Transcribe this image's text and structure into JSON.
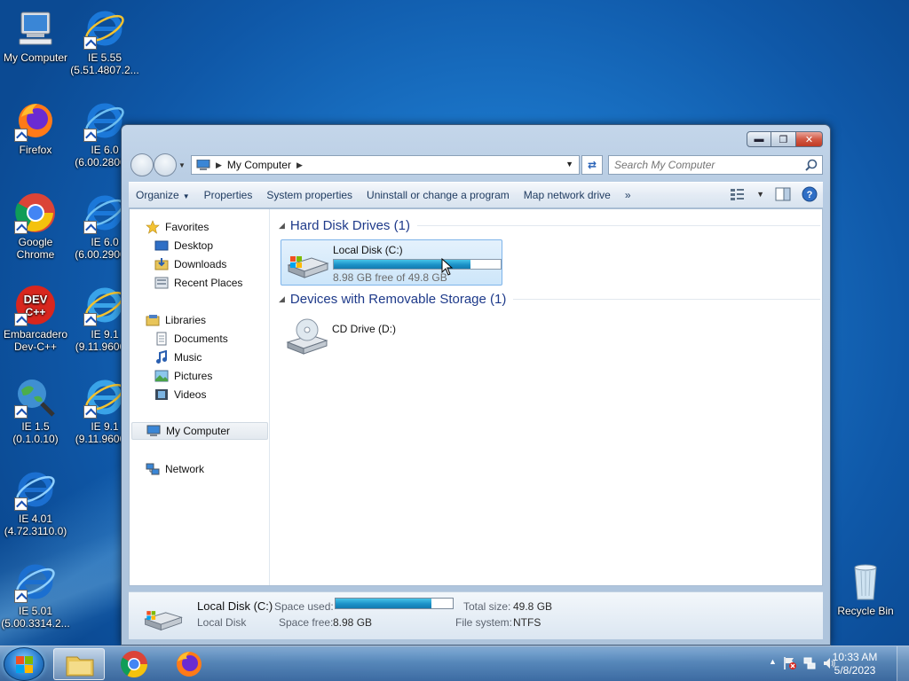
{
  "desktop": {
    "icons": [
      {
        "label": "My Computer"
      },
      {
        "label": "IE 5.55\n(5.51.4807.2..."
      },
      {
        "label": "Firefox"
      },
      {
        "label": "IE 6.0\n(6.00.2800..."
      },
      {
        "label": "Google\nChrome"
      },
      {
        "label": "IE 6.0\n(6.00.2900..."
      },
      {
        "label": "Embarcadero\nDev-C++"
      },
      {
        "label": "IE 9.1\n(9.11.9600..."
      },
      {
        "label": "IE 1.5\n(0.1.0.10)"
      },
      {
        "label": "IE 9.1\n(9.11.9600..."
      },
      {
        "label": "IE 4.01\n(4.72.3110.0)"
      },
      {
        "label": "IE 5.01\n(5.00.3314.2..."
      },
      {
        "label": "Recycle Bin"
      }
    ]
  },
  "window": {
    "address": {
      "location": "My Computer"
    },
    "search": {
      "placeholder": "Search My Computer"
    },
    "toolbar": {
      "organize": "Organize",
      "properties": "Properties",
      "system_properties": "System properties",
      "uninstall": "Uninstall or change a program",
      "map_drive": "Map network drive",
      "more": "»"
    },
    "nav": {
      "favorites": "Favorites",
      "desktop": "Desktop",
      "downloads": "Downloads",
      "recent": "Recent Places",
      "libraries": "Libraries",
      "documents": "Documents",
      "music": "Music",
      "pictures": "Pictures",
      "videos": "Videos",
      "my_computer": "My Computer",
      "network": "Network"
    },
    "groups": {
      "hdd": "Hard Disk Drives (1)",
      "removable": "Devices with Removable Storage (1)"
    },
    "drives": {
      "c": {
        "name": "Local Disk (C:)",
        "free_text": "8.98 GB free of 49.8 GB",
        "used_fraction": 0.82
      },
      "d": {
        "name": "CD Drive (D:)"
      }
    },
    "details": {
      "name": "Local Disk (C:)",
      "type": "Local Disk",
      "space_used_label": "Space used:",
      "space_free_label": "Space free:",
      "space_free": "8.98 GB",
      "total_size_label": "Total size:",
      "total_size": "49.8 GB",
      "file_system_label": "File system:",
      "file_system": "NTFS",
      "used_fraction": 0.82
    }
  },
  "taskbar": {
    "clock": {
      "time": "10:33 AM",
      "date": "5/8/2023"
    }
  },
  "colors": {
    "accent": "#1c92c8",
    "desktop": "#1a73c6"
  }
}
